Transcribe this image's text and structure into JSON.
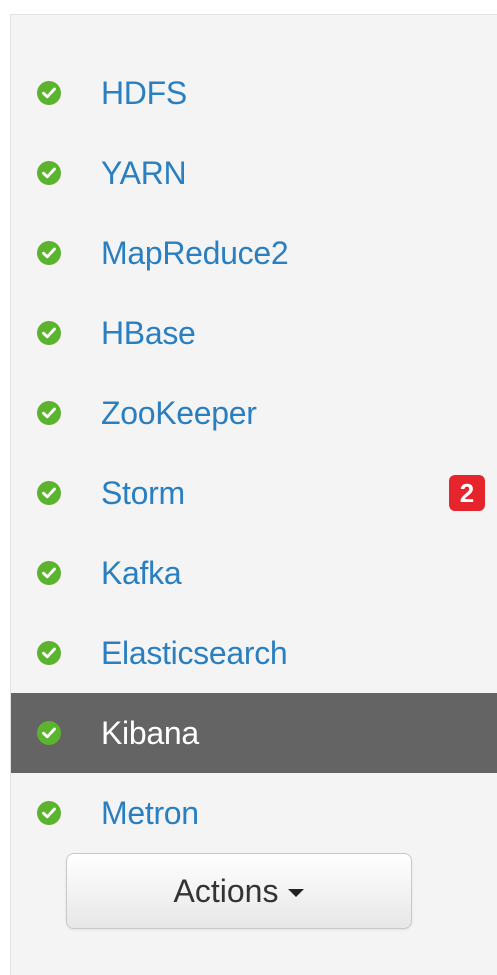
{
  "colors": {
    "status_ok": "#5cb32e",
    "link": "#2a7fc1",
    "active_bg": "#646464",
    "badge_bg": "#e5242b"
  },
  "services": [
    {
      "name": "HDFS",
      "status_icon": "check-circle-icon",
      "active": false
    },
    {
      "name": "YARN",
      "status_icon": "check-circle-icon",
      "active": false
    },
    {
      "name": "MapReduce2",
      "status_icon": "check-circle-icon",
      "active": false
    },
    {
      "name": "HBase",
      "status_icon": "check-circle-icon",
      "active": false
    },
    {
      "name": "ZooKeeper",
      "status_icon": "check-circle-icon",
      "active": false
    },
    {
      "name": "Storm",
      "status_icon": "check-circle-icon",
      "active": false,
      "alert_count": "2"
    },
    {
      "name": "Kafka",
      "status_icon": "check-circle-icon",
      "active": false
    },
    {
      "name": "Elasticsearch",
      "status_icon": "check-circle-icon",
      "active": false
    },
    {
      "name": "Kibana",
      "status_icon": "check-circle-icon",
      "active": true
    },
    {
      "name": "Metron",
      "status_icon": "check-circle-icon",
      "active": false
    }
  ],
  "actions": {
    "label": "Actions",
    "caret_icon": "caret-down-icon"
  }
}
